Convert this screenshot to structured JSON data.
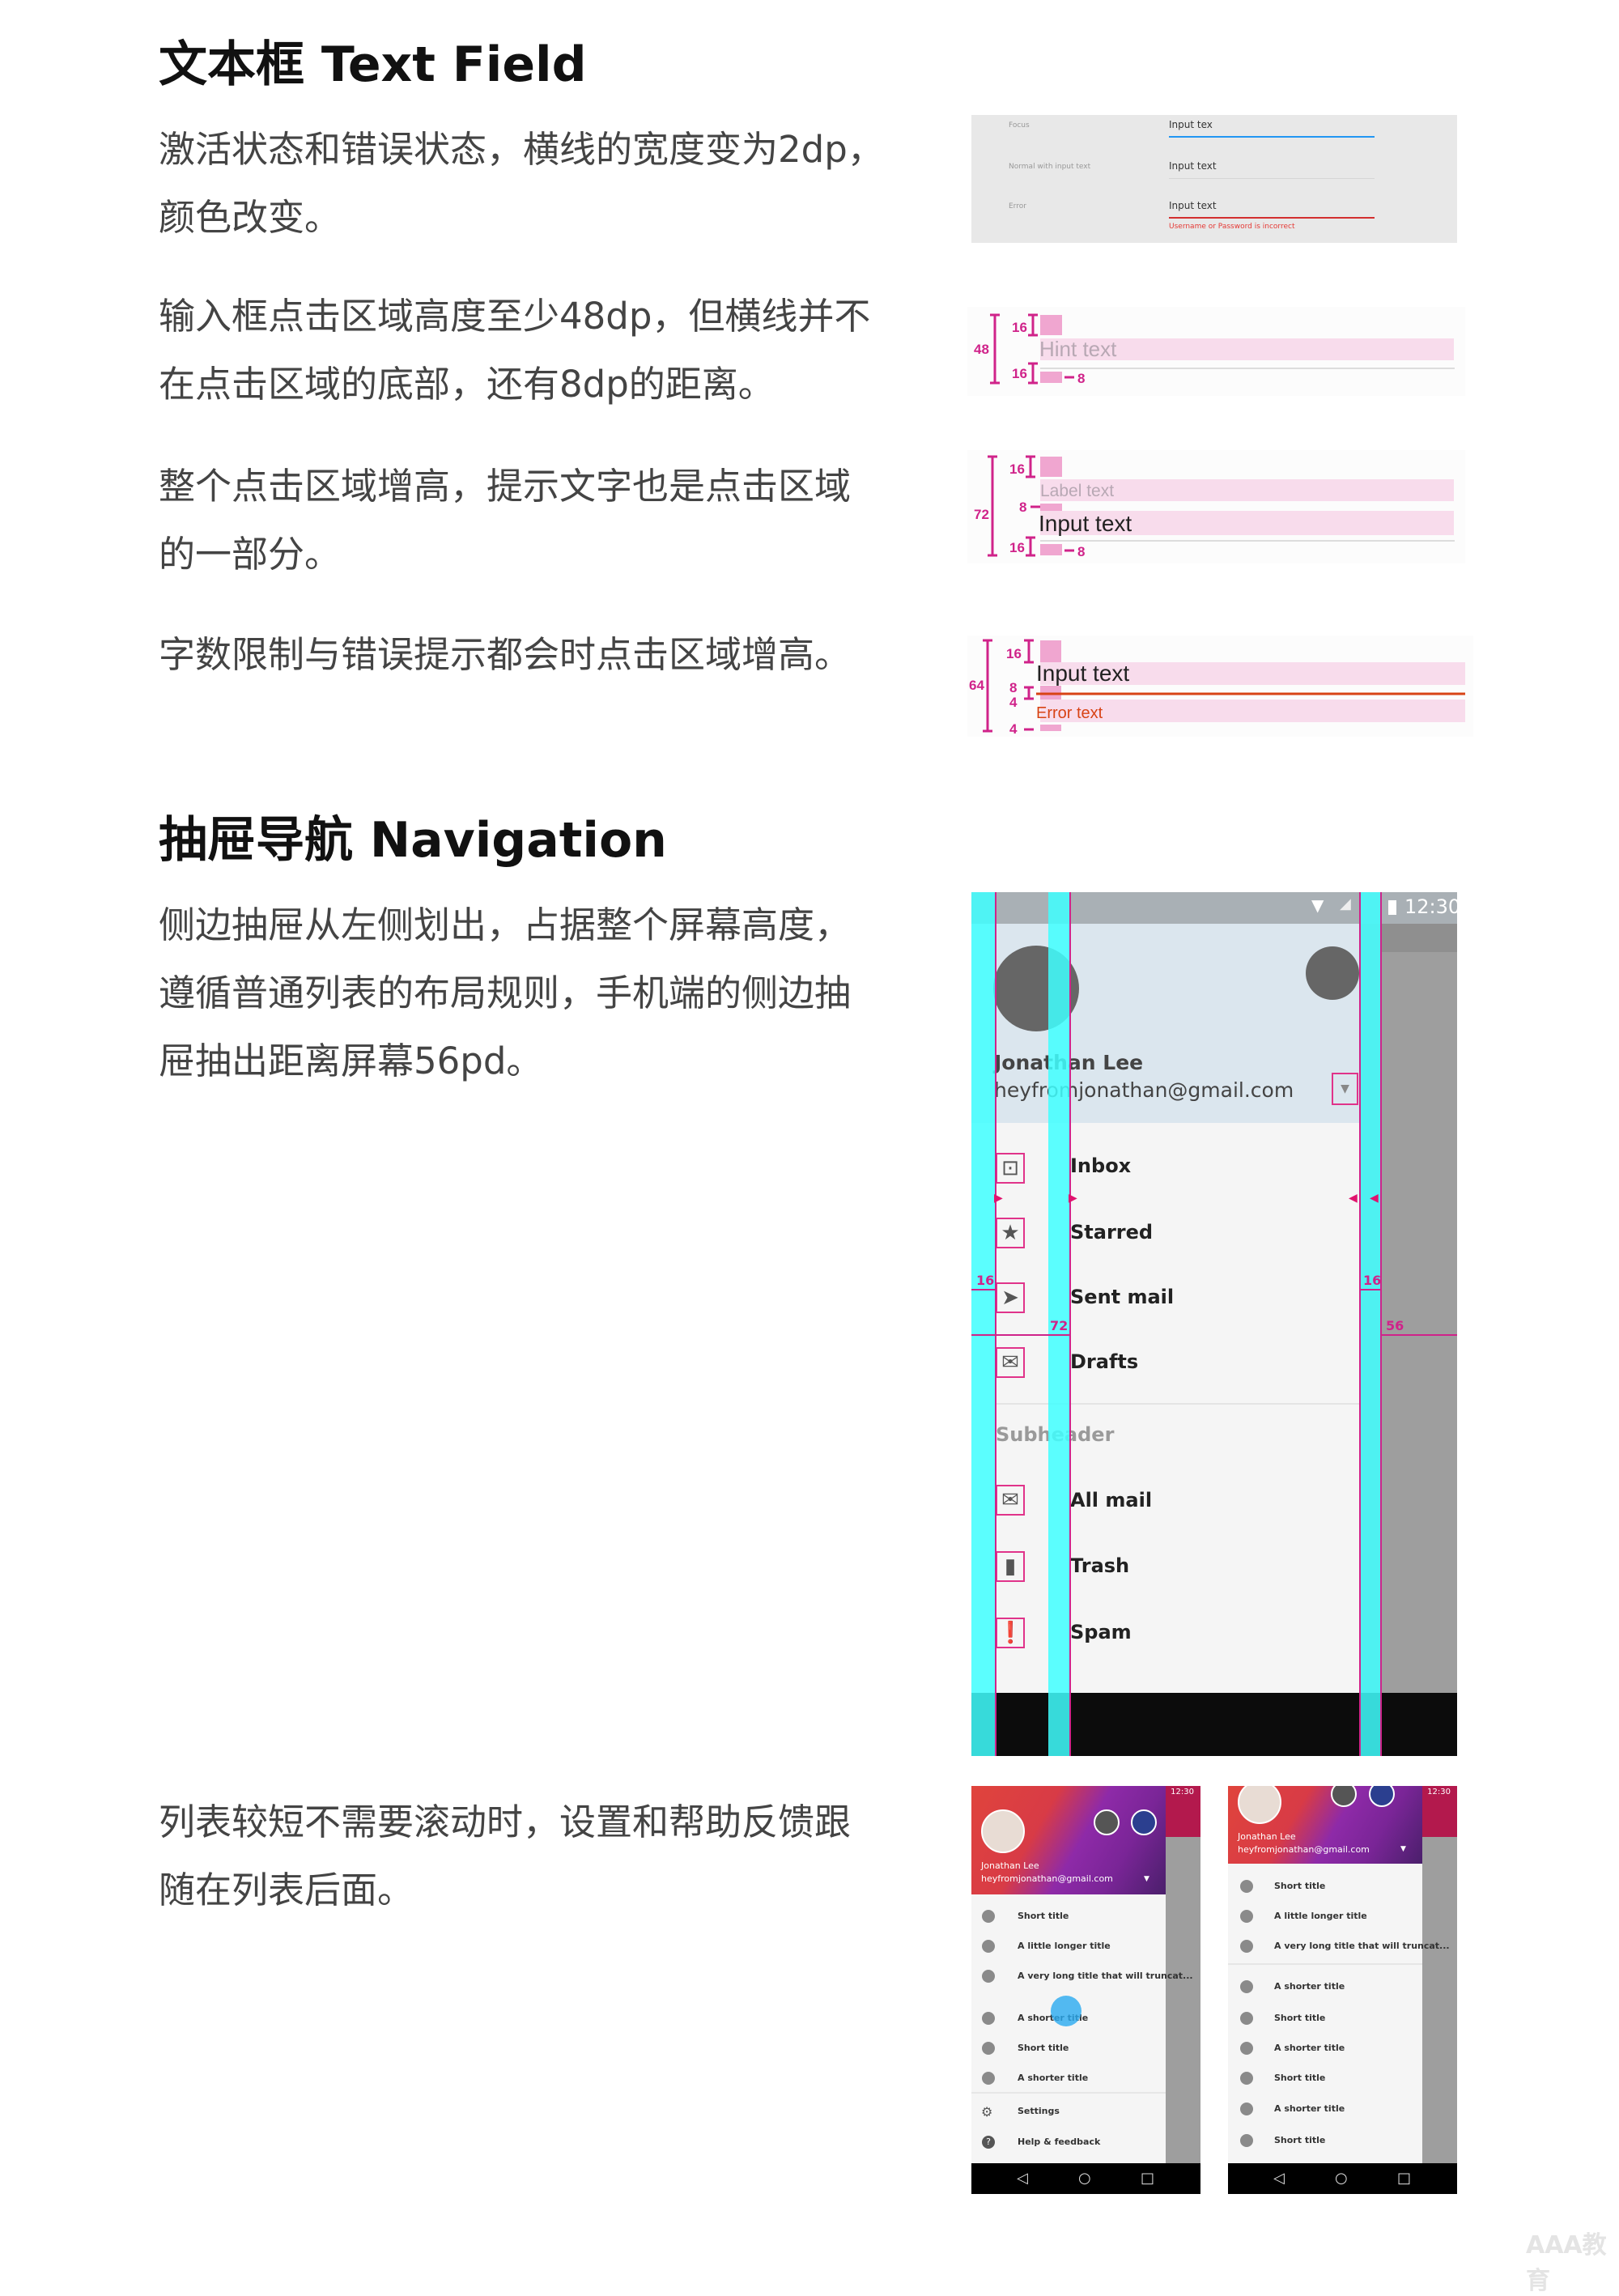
{
  "section1": {
    "title": "文本框 Text Field",
    "paragraphs": [
      [
        "激活状态和错误状态，横线的宽度变为2dp，",
        "颜色改变。"
      ],
      [
        "输入框点击区域高度至少48dp，但横线并不",
        "在点击区域的底部，还有8dp的距离。"
      ],
      [
        "整个点击区域增高，提示文字也是点击区域",
        "的一部分。"
      ],
      [
        "字数限制与错误提示都会时点击区域增高。"
      ]
    ],
    "states_image": {
      "focus_label": "Focus",
      "focus_value": "Input tex",
      "normal_label": "Normal with input text",
      "normal_value": "Input text",
      "error_label": "Error",
      "error_value": "Input text",
      "error_message": "Username or Password is incorrect",
      "colors": {
        "focus": "#2196f3",
        "error": "#d32f2f"
      }
    },
    "hint_spec": {
      "total": "48",
      "top": "16",
      "bottom": "16",
      "line_gap": "8",
      "hint": "Hint text"
    },
    "label_spec": {
      "total": "72",
      "top": "16",
      "gap": "8",
      "bottom": "16",
      "line_gap": "8",
      "label": "Label text",
      "input": "Input text"
    },
    "error_spec": {
      "total": "64",
      "top": "16",
      "gap1": "8",
      "gap2": "4",
      "bottom": "4",
      "input": "Input text",
      "error": "Error text"
    },
    "spec_color": "#d0238a"
  },
  "section2": {
    "title": "抽屉导航 Navigation",
    "paragraphs": [
      [
        "侧边抽屉从左侧划出，占据整个屏幕高度，",
        "遵循普通列表的布局规则，手机端的侧边抽",
        "屉抽出距离屏幕56pd。"
      ],
      [
        "列表较短不需要滚动时，设置和帮助反馈跟",
        "随在列表后面。"
      ]
    ],
    "drawer_image": {
      "time": "12:30",
      "name": "Jonathan Lee",
      "email": "heyfromjonathan@gmail.com",
      "items": [
        {
          "label": "Inbox",
          "icon": "inbox-icon"
        },
        {
          "label": "Starred",
          "icon": "star-icon"
        },
        {
          "label": "Sent mail",
          "icon": "send-icon"
        },
        {
          "label": "Drafts",
          "icon": "drafts-icon"
        }
      ],
      "subheader": "Subheader",
      "items2": [
        {
          "label": "All mail",
          "icon": "mail-icon"
        },
        {
          "label": "Trash",
          "icon": "trash-icon"
        },
        {
          "label": "Spam",
          "icon": "spam-icon"
        }
      ],
      "measures": {
        "left_margin": "16",
        "text_inset": "72",
        "right_margin": "16",
        "screen_gap": "56"
      }
    },
    "phone_left": {
      "time": "12:30",
      "name": "Jonathan Lee",
      "email": "heyfromjonathan@gmail.com",
      "items": [
        "Short title",
        "A little longer title",
        "A very long title that will truncat...",
        "A shorter title",
        "Short title",
        "A shorter title"
      ],
      "settings": "Settings",
      "help": "Help & feedback"
    },
    "phone_right": {
      "time": "12:30",
      "name": "Jonathan Lee",
      "email": "heyfromjonathan@gmail.com",
      "items": [
        "Short title",
        "A little longer title",
        "A very long title that will truncat..."
      ],
      "items2": [
        "A shorter title",
        "Short title",
        "A shorter title",
        "Short title",
        "A shorter title",
        "Short title"
      ]
    }
  },
  "watermark": "AAA教育"
}
